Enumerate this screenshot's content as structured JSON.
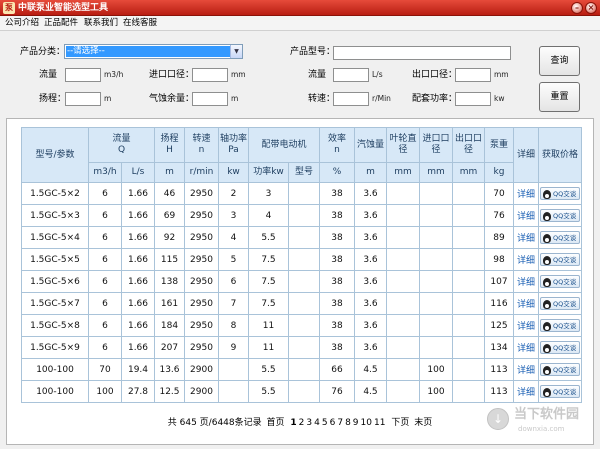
{
  "window": {
    "title": "中联泵业智能选型工具"
  },
  "menu": [
    "公司介绍",
    "正品配件",
    "联系我们",
    "在线客服"
  ],
  "search": {
    "category_label": "产品分类：",
    "category_value": "--请选择--",
    "model_label": "产品型号：",
    "model_value": "",
    "flow_label": "流量",
    "flow_unit": "m3/h",
    "inlet_label": "进口口径：",
    "inlet_unit": "mm",
    "flow2_label": "流量",
    "flow2_unit": "L/s",
    "outlet_label": "出口口径：",
    "outlet_unit": "mm",
    "head_label": "扬程：",
    "head_unit": "m",
    "npsh_label": "气蚀余量：",
    "npsh_unit": "m",
    "speed_label": "转速：",
    "speed_unit": "r/Min",
    "power_label": "配套功率：",
    "power_unit": "kw",
    "query_button": "查询",
    "reset_button": "重置"
  },
  "table": {
    "header1": {
      "model": "型号/参数",
      "flow": "流量\nQ",
      "head": "扬程\nH",
      "speed": "转速\nn",
      "shaft": "轴功率\nPa",
      "motor": "配带电动机",
      "eff": "效率\nn",
      "npsh": "汽蚀量",
      "impeller": "叶轮直\n径",
      "inlet": "进口口\n径",
      "outlet": "出口口\n径",
      "weight": "泵重",
      "detail": "详细",
      "price": "获取价格"
    },
    "header2": [
      "m3/h",
      "L/s",
      "m",
      "r/min",
      "kw",
      "功率kw",
      "型号",
      "%",
      "m",
      "mm",
      "mm",
      "mm",
      "kg"
    ],
    "rows": [
      [
        "1.5GC-5×2",
        "6",
        "1.66",
        "46",
        "2950",
        "2",
        "3",
        "",
        "38",
        "3.6",
        "",
        "",
        "",
        "70"
      ],
      [
        "1.5GC-5×3",
        "6",
        "1.66",
        "69",
        "2950",
        "3",
        "4",
        "",
        "38",
        "3.6",
        "",
        "",
        "",
        "76"
      ],
      [
        "1.5GC-5×4",
        "6",
        "1.66",
        "92",
        "2950",
        "4",
        "5.5",
        "",
        "38",
        "3.6",
        "",
        "",
        "",
        "89"
      ],
      [
        "1.5GC-5×5",
        "6",
        "1.66",
        "115",
        "2950",
        "5",
        "7.5",
        "",
        "38",
        "3.6",
        "",
        "",
        "",
        "98"
      ],
      [
        "1.5GC-5×6",
        "6",
        "1.66",
        "138",
        "2950",
        "6",
        "7.5",
        "",
        "38",
        "3.6",
        "",
        "",
        "",
        "107"
      ],
      [
        "1.5GC-5×7",
        "6",
        "1.66",
        "161",
        "2950",
        "7",
        "7.5",
        "",
        "38",
        "3.6",
        "",
        "",
        "",
        "116"
      ],
      [
        "1.5GC-5×8",
        "6",
        "1.66",
        "184",
        "2950",
        "8",
        "11",
        "",
        "38",
        "3.6",
        "",
        "",
        "",
        "125"
      ],
      [
        "1.5GC-5×9",
        "6",
        "1.66",
        "207",
        "2950",
        "9",
        "11",
        "",
        "38",
        "3.6",
        "",
        "",
        "",
        "134"
      ],
      [
        "100-100",
        "70",
        "19.4",
        "13.6",
        "2900",
        "",
        "5.5",
        "",
        "66",
        "4.5",
        "",
        "100",
        "",
        "113"
      ],
      [
        "100-100",
        "100",
        "27.8",
        "12.5",
        "2900",
        "",
        "5.5",
        "",
        "76",
        "4.5",
        "",
        "100",
        "",
        "113"
      ]
    ],
    "detail_link": "详细",
    "qq_label": "QQ交谈"
  },
  "pager": {
    "summary": "共 645 页/6448条记录",
    "first": "首页",
    "pages": [
      "1",
      "2",
      "3",
      "4",
      "5",
      "6",
      "7",
      "8",
      "9",
      "10",
      "11"
    ],
    "current": "1",
    "next": "下页",
    "last": "末页"
  },
  "watermark": {
    "text": "当下软件园",
    "sub": "downxia.com"
  }
}
